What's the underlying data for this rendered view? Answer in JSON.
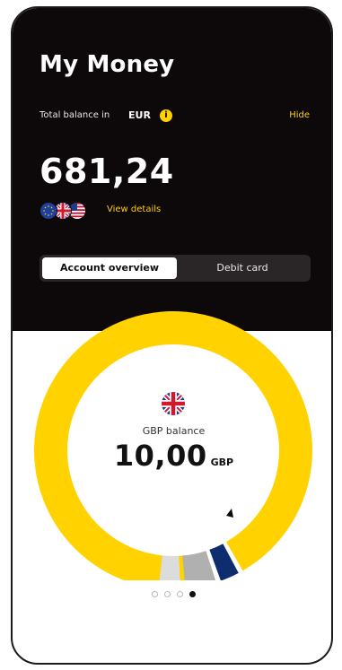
{
  "header": {
    "title": "My Money",
    "total_balance_label": "Total balance in",
    "currency": "EUR",
    "info_icon": "i",
    "hide_label": "Hide",
    "amount": "681,24",
    "view_details_label": "View details",
    "flags": [
      "eu-flag-icon",
      "uk-flag-icon",
      "us-flag-icon"
    ]
  },
  "tabs": [
    {
      "label": "Account overview",
      "selected": true
    },
    {
      "label": "Debit card",
      "selected": false
    }
  ],
  "balance_card": {
    "label": "GBP balance",
    "amount": "10,00",
    "currency": "GBP"
  },
  "pager": {
    "total": 4,
    "active_index": 3
  },
  "colors": {
    "accent": "#ffd200",
    "dark_bg": "#0d0809",
    "navy_segment": "#0e2d6e",
    "grey_segment": "#b0b0b0",
    "light_grey_segment": "#dcdcdc"
  }
}
